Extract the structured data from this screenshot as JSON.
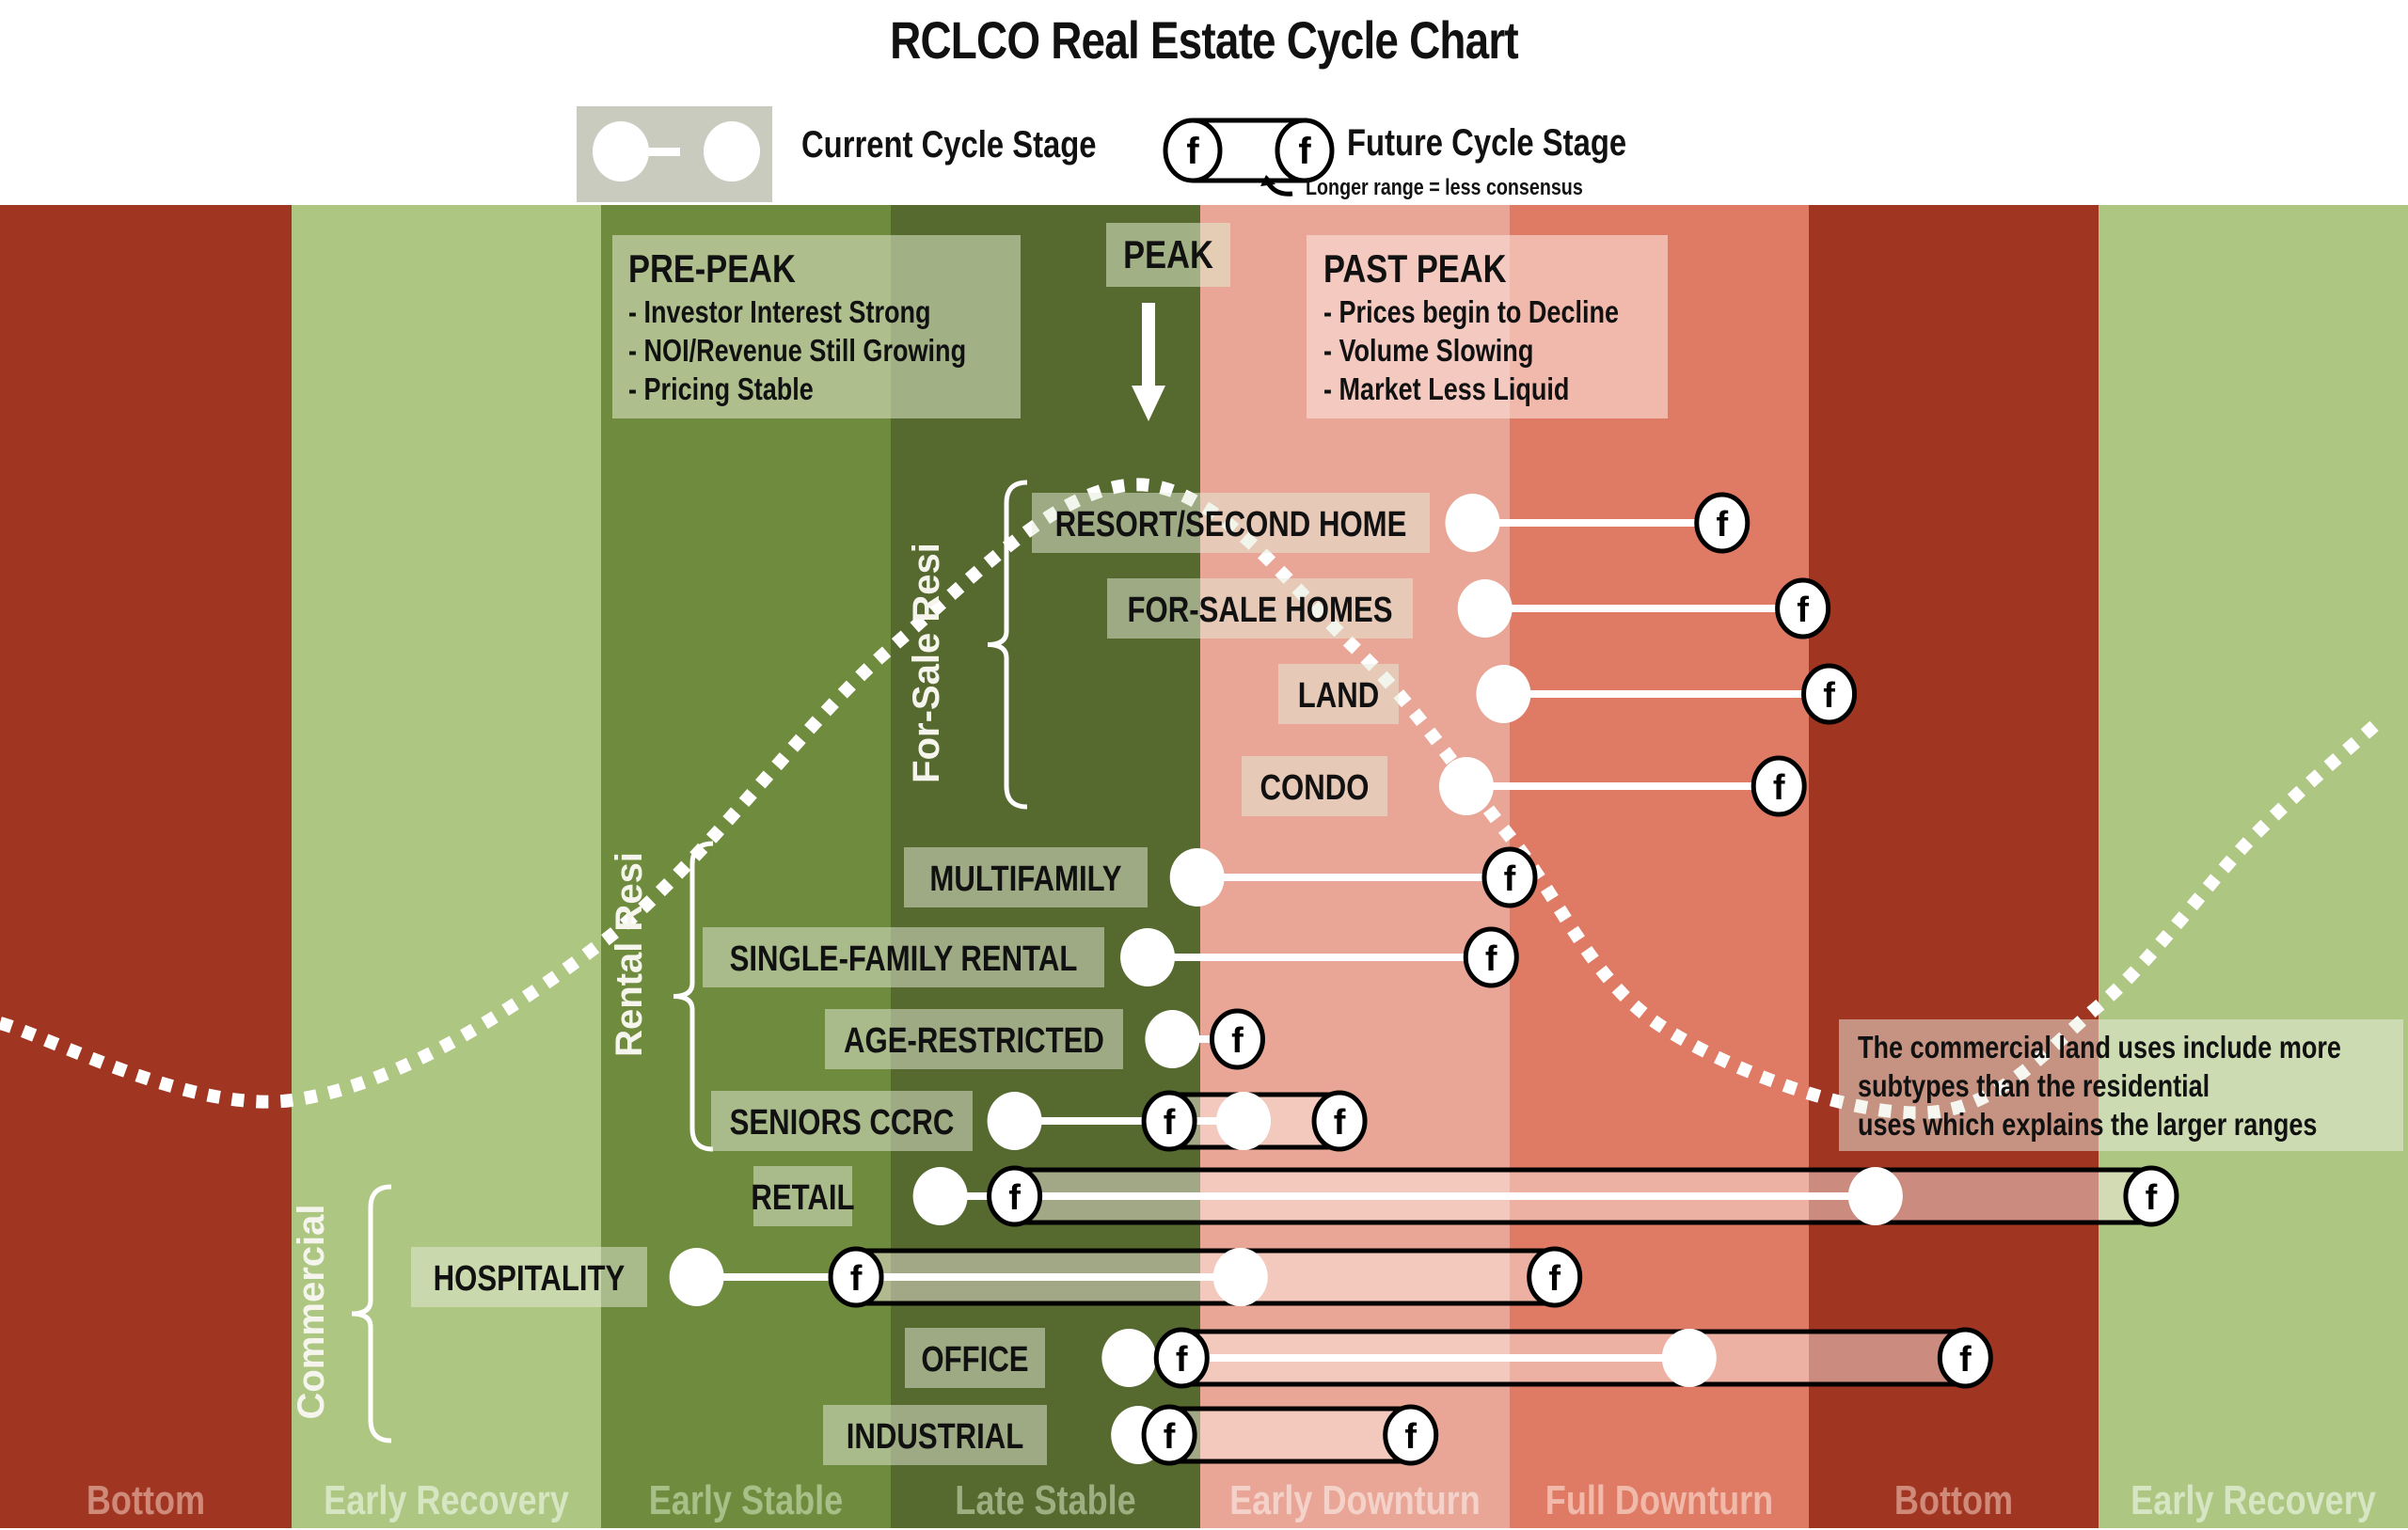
{
  "chart_data": {
    "type": "table",
    "title": "RCLCO Real Estate Cycle Chart",
    "legend": {
      "current_label": "Current Cycle Stage",
      "future_label": "Future Cycle Stage",
      "future_note": "Longer range = less consensus",
      "future_marker": "f",
      "placement": "top-center"
    },
    "stages": [
      {
        "name": "Bottom",
        "color": "#a03622",
        "label_color": "#cf8a7a"
      },
      {
        "name": "Early Recovery",
        "color": "#adc682",
        "label_color": "#d6e5c2"
      },
      {
        "name": "Early Stable",
        "color": "#6f8b3e",
        "label_color": "#a8bf88"
      },
      {
        "name": "Late Stable",
        "color": "#56692f",
        "label_color": "#9dae80"
      },
      {
        "name": "Early Downturn",
        "color": "#e9a696",
        "label_color": "#f4d2c9"
      },
      {
        "name": "Full Downturn",
        "color": "#df7a64",
        "label_color": "#f0b9aa"
      },
      {
        "name": "Bottom",
        "color": "#a03622",
        "label_color": "#cf8a7a"
      },
      {
        "name": "Early Recovery",
        "color": "#adc682",
        "label_color": "#d6e5c2"
      }
    ],
    "x_axis": {
      "unit": "cycle stage index (0 = start of first Bottom band, 8 = end of last Early Recovery band)",
      "range": [
        0,
        8
      ]
    },
    "cycle_curve": {
      "style": "dotted",
      "x": [
        0,
        1,
        2,
        3,
        3.8,
        4.5,
        5,
        5.5,
        6.4,
        7,
        7.5,
        7.9
      ],
      "y_relative": [
        -0.05,
        -0.12,
        0.25,
        0.72,
        0.98,
        0.72,
        0.42,
        0.12,
        -0.02,
        0.15,
        0.42,
        0.6
      ]
    },
    "annotations": [
      {
        "title": "PRE-PEAK",
        "lines": [
          "- Investor Interest Strong",
          "- NOI/Revenue Still Growing",
          "- Pricing Stable"
        ]
      },
      {
        "title": "PEAK",
        "lines": []
      },
      {
        "title": "PAST PEAK",
        "lines": [
          "- Prices begin to Decline",
          "- Volume Slowing",
          "- Market Less Liquid"
        ]
      },
      {
        "title": "",
        "lines": [
          "The commercial land uses include more",
          "subtypes than the residential",
          "uses which explains the larger ranges"
        ]
      }
    ],
    "groups": [
      {
        "name": "For-Sale Resi",
        "items": [
          "RESORT/SECOND HOME",
          "FOR-SALE HOMES",
          "LAND",
          "CONDO"
        ]
      },
      {
        "name": "Rental Resi",
        "items": [
          "MULTIFAMILY",
          "SINGLE-FAMILY RENTAL",
          "AGE-RESTRICTED",
          "SENIORS CCRC"
        ]
      },
      {
        "name": "Commercial",
        "items": [
          "RETAIL",
          "HOSPITALITY",
          "OFFICE",
          "INDUSTRIAL"
        ]
      }
    ],
    "series": [
      {
        "name": "RESORT/SECOND HOME",
        "group": "For-Sale Resi",
        "current": 4.88,
        "future": [
          5.71
        ]
      },
      {
        "name": "FOR-SALE HOMES",
        "group": "For-Sale Resi",
        "current": 4.92,
        "future": [
          5.98
        ]
      },
      {
        "name": "LAND",
        "group": "For-Sale Resi",
        "current": 4.98,
        "future": [
          6.07
        ]
      },
      {
        "name": "CONDO",
        "group": "For-Sale Resi",
        "current": 4.86,
        "future": [
          5.9
        ]
      },
      {
        "name": "MULTIFAMILY",
        "group": "Rental Resi",
        "current": 3.99,
        "future": [
          5.0
        ]
      },
      {
        "name": "SINGLE-FAMILY RENTAL",
        "group": "Rental Resi",
        "current": 3.83,
        "future": [
          4.94
        ]
      },
      {
        "name": "AGE-RESTRICTED",
        "group": "Rental Resi",
        "current": 3.91,
        "future": [
          4.12
        ]
      },
      {
        "name": "SENIORS CCRC",
        "group": "Rental Resi",
        "current": 3.4,
        "future": [
          3.9,
          4.45
        ],
        "future_mid": 4.14
      },
      {
        "name": "RETAIL",
        "group": "Commercial",
        "current": 3.16,
        "future": [
          3.4,
          7.17
        ],
        "future_mid": 6.23
      },
      {
        "name": "HOSPITALITY",
        "group": "Commercial",
        "current": 2.33,
        "future": [
          2.88,
          5.15
        ],
        "future_mid": 4.13
      },
      {
        "name": "OFFICE",
        "group": "Commercial",
        "current": 3.77,
        "future": [
          3.94,
          6.54
        ],
        "future_mid": 5.6
      },
      {
        "name": "INDUSTRIAL",
        "group": "Commercial",
        "current": 3.8,
        "future": [
          3.9,
          4.68
        ]
      }
    ]
  }
}
